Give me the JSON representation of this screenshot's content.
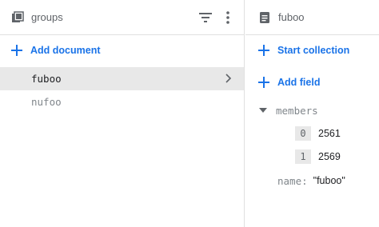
{
  "left": {
    "collection_name": "groups",
    "header_icon": "collection-icon",
    "add_document_label": "Add document",
    "documents": [
      {
        "id": "fuboo",
        "selected": true
      },
      {
        "id": "nufoo",
        "selected": false
      }
    ]
  },
  "right": {
    "document_name": "fuboo",
    "header_icon": "document-icon",
    "start_collection_label": "Start collection",
    "add_field_label": "Add field",
    "fields": {
      "members": {
        "key": "members",
        "items": [
          {
            "index": "0",
            "value": "2561"
          },
          {
            "index": "1",
            "value": "2569"
          }
        ]
      },
      "name": {
        "key": "name:",
        "value": "\"fuboo\""
      }
    }
  },
  "colors": {
    "accent": "#1a73e8",
    "selected_row": "#e8e8e8",
    "border": "#e0e0e0"
  }
}
